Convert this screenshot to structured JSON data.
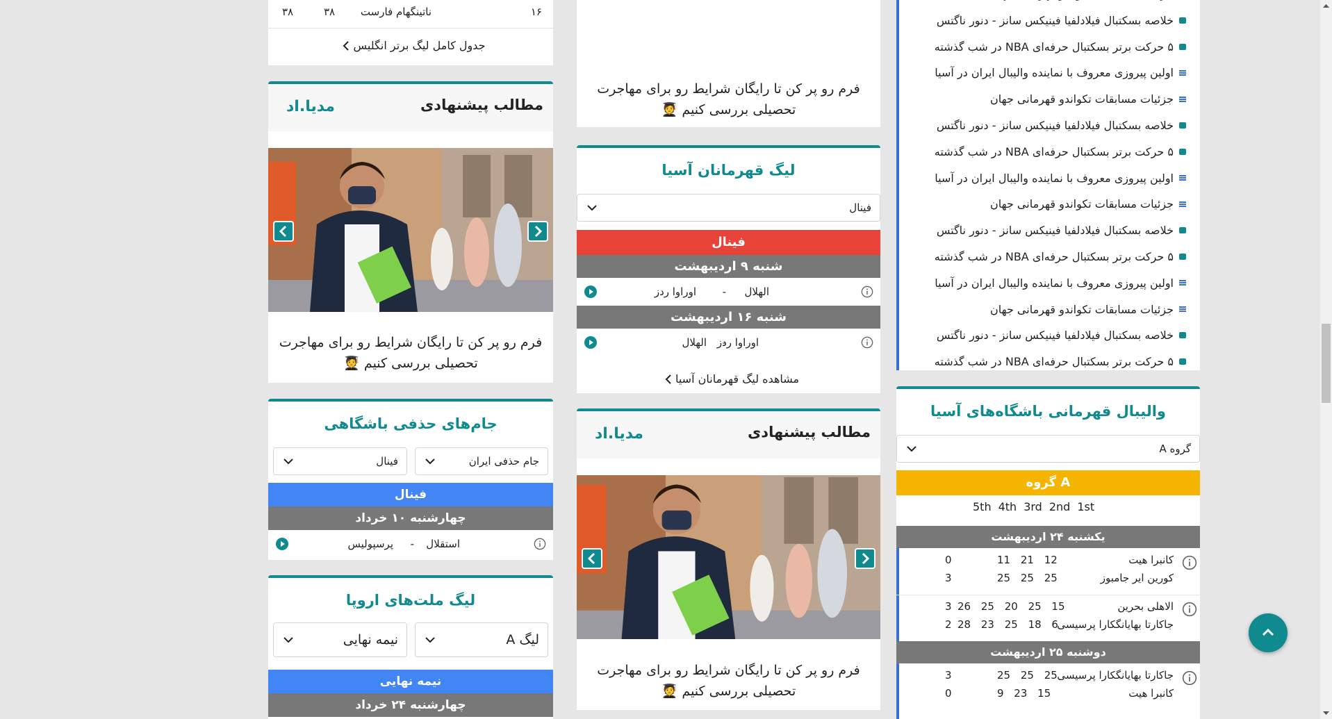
{
  "colors": {
    "teal": "#0f8a8f",
    "red": "#e84339",
    "blue": "#4285f4",
    "gray": "#787878",
    "yellow": "#f4b400"
  },
  "left": {
    "table_row": {
      "rank": "۱۶",
      "team": "ناتینگهام فارست",
      "v1": "۳۸",
      "v2": "۳۸"
    },
    "full_table_link": "جدول کامل لیگ برتر انگلیس",
    "recommended": {
      "title": "مطالب پیشنهادی",
      "logo": "مدیا.اد",
      "caption": "فرم رو پر کن تا رایگان شرایط رو برای مهاجرت تحصیلی بررسی کنیم 🧑‍🎓"
    },
    "cups": {
      "title": "جام‌های حذفی باشگاهی",
      "select_competition": "جام حذفی ایران",
      "select_stage": "فینال",
      "stage_bar": "فینال",
      "date_bar": "چهارشنبه ۱۰ خرداد",
      "match": {
        "home": "استقلال",
        "sep": "-",
        "away": "پرسپولیس"
      }
    },
    "nations": {
      "title": "لیگ ملت‌های اروپا",
      "select_league": "لیگ A",
      "select_stage": "نیمه نهایی",
      "stage_bar": "نیمه نهایی",
      "date_bar": "چهارشنبه ۲۴ خرداد"
    }
  },
  "middle": {
    "top_caption": "فرم رو پر کن تا رایگان شرایط رو برای مهاجرت تحصیلی بررسی کنیم 🧑‍🎓",
    "acl": {
      "title": "لیگ قهرمانان آسیا",
      "select_stage": "فینال",
      "stage_bar": "فینال",
      "games": [
        {
          "date": "شنبه ۹ اردیبهشت",
          "home": "الهلال",
          "sep": "-",
          "away": "اوراوا ردز"
        },
        {
          "date": "شنبه ۱۶ اردیبهشت",
          "home": "اوراوا ردز",
          "sep": "-",
          "away": "الهلال"
        }
      ],
      "more_link": "مشاهده لیگ قهرمانان آسیا"
    },
    "recommended": {
      "title": "مطالب پیشنهادی",
      "logo": "مدیا.اد",
      "caption": "فرم رو پر کن تا رایگان شرایط رو برای مهاجرت تحصیلی بررسی کنیم 🧑‍🎓"
    }
  },
  "right": {
    "news": [
      {
        "icon": "text-icon",
        "text": "جزئیات مسابقات تکواندو قهرمانی جهان"
      },
      {
        "icon": "video-icon",
        "text": "خلاصه بسکتبال فیلادلفیا فینیکس سانز - دنور ناگتس"
      },
      {
        "icon": "video-icon",
        "text": "۵ حرکت برتر بسکتبال حرفه‌ای NBA در شب گذشته"
      },
      {
        "icon": "text-icon",
        "text": "اولین پیروزی معروف با نماینده والیبال ایران در آسیا"
      },
      {
        "icon": "text-icon",
        "text": "جزئیات مسابقات تکواندو قهرمانی جهان"
      },
      {
        "icon": "video-icon",
        "text": "خلاصه بسکتبال فیلادلفیا فینیکس سانز - دنور ناگتس"
      },
      {
        "icon": "video-icon",
        "text": "۵ حرکت برتر بسکتبال حرفه‌ای NBA در شب گذشته"
      },
      {
        "icon": "text-icon",
        "text": "اولین پیروزی معروف با نماینده والیبال ایران در آسیا"
      },
      {
        "icon": "text-icon",
        "text": "جزئیات مسابقات تکواندو قهرمانی جهان"
      },
      {
        "icon": "video-icon",
        "text": "خلاصه بسکتبال فیلادلفیا فینیکس سانز - دنور ناگتس"
      },
      {
        "icon": "video-icon",
        "text": "۵ حرکت برتر بسکتبال حرفه‌ای NBA در شب گذشته"
      },
      {
        "icon": "text-icon",
        "text": "اولین پیروزی معروف با نماینده والیبال ایران در آسیا"
      },
      {
        "icon": "text-icon",
        "text": "جزئیات مسابقات تکواندو قهرمانی جهان"
      },
      {
        "icon": "video-icon",
        "text": "خلاصه بسکتبال فیلادلفیا فینیکس سانز - دنور ناگتس"
      },
      {
        "icon": "video-icon",
        "text": "۵ حرکت برتر بسکتبال حرفه‌ای NBA در شب گذشته"
      }
    ],
    "volley": {
      "title": "والیبال قهرمانی باشگاه‌های آسیا",
      "select_group": "گروه A",
      "group_bar": "گروه A",
      "set_headers": [
        "1st",
        "2nd",
        "3rd",
        "4th",
        "5th"
      ],
      "days": [
        {
          "date": "یکشنبه ۲۴ اردیبهشت",
          "matches": [
            {
              "team1": "کانبرا هیت",
              "sets1": "11 21 12",
              "total1": "0",
              "team2": "کورین ایر جامبوز",
              "sets2": "25 25 25",
              "total2": "3"
            },
            {
              "team1": "الاهلی بحرین",
              "sets1": "26 25 20 25 15",
              "total1": "3",
              "team2": "جاکارتا بهایانگکارا پرسیسی",
              "sets2": "28 23 25 18 6",
              "total2": "2"
            }
          ]
        },
        {
          "date": "دوشنبه ۲۵ اردیبهشت",
          "matches": [
            {
              "team1": "جاکارتا بهایانگکارا پرسیسی",
              "sets1": "25 25 25",
              "total1": "3",
              "team2": "کانبرا هیت",
              "sets2": "9 23 15",
              "total2": "0"
            }
          ]
        }
      ]
    }
  }
}
